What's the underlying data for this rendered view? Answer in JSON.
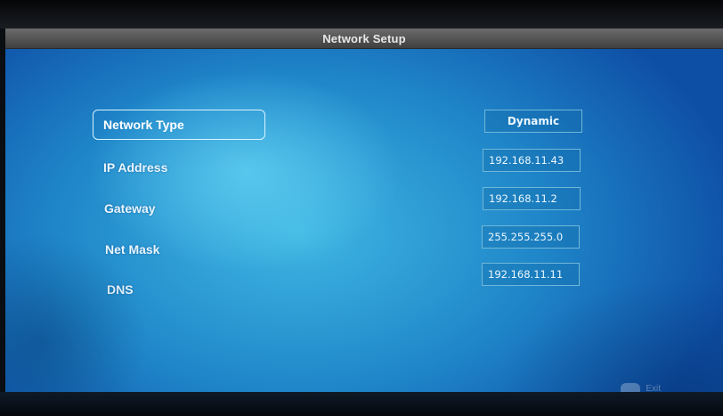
{
  "window": {
    "title": "Network Setup"
  },
  "fields": [
    {
      "label": "Network Type",
      "value": "Dynamic"
    },
    {
      "label": "IP Address",
      "value": "192.168.11.43"
    },
    {
      "label": "Gateway",
      "value": "192.168.11.2"
    },
    {
      "label": "Net Mask",
      "value": "255.255.255.0"
    },
    {
      "label": "DNS",
      "value": "192.168.11.11"
    }
  ],
  "footer": {
    "exit_label": "Exit"
  },
  "colors": {
    "title_bar": "#4f4f4f",
    "background_top": "#3fb6e2",
    "background_edge": "#0e4fa6",
    "selection_border": "#d9f4ff",
    "value_border": "#6fb7d8"
  }
}
